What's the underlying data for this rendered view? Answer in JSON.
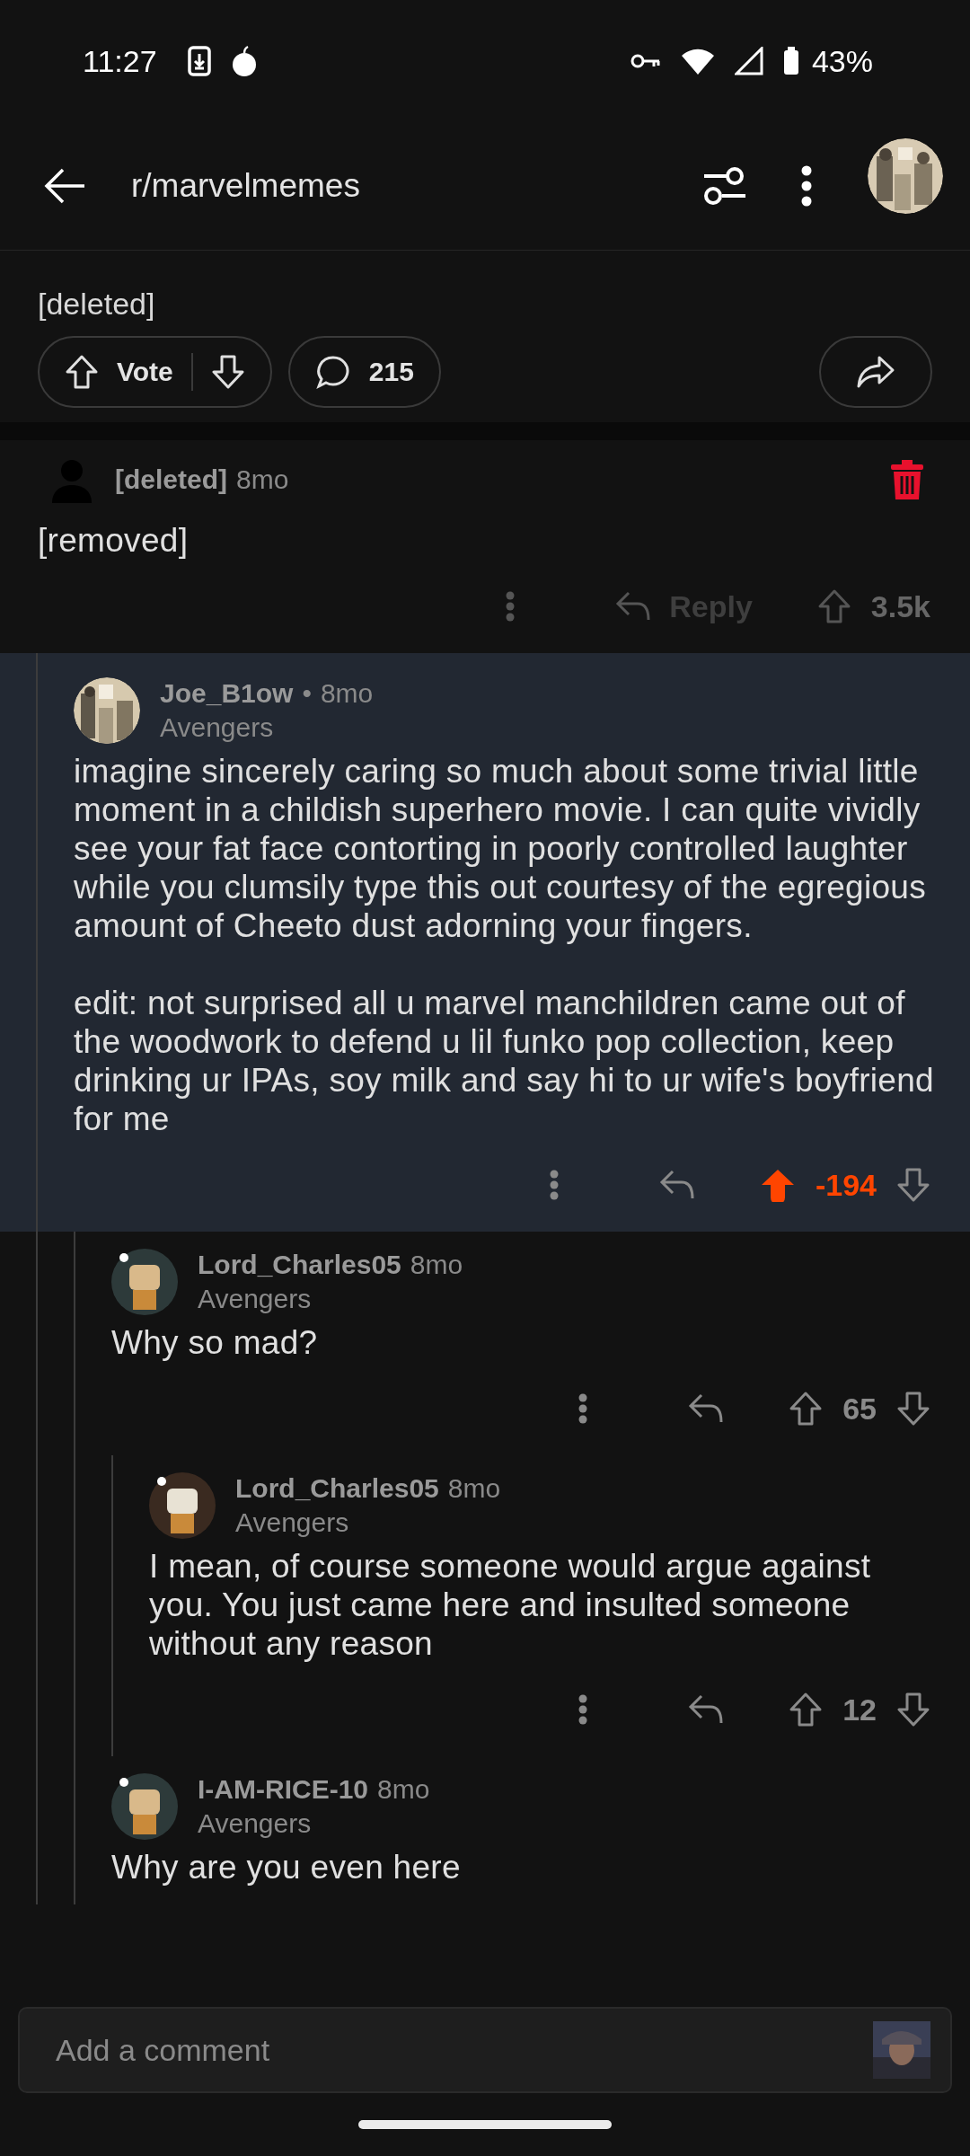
{
  "status_bar": {
    "time": "11:27",
    "battery": "43%"
  },
  "top_bar": {
    "title": "r/marvelmemes"
  },
  "post": {
    "body": "[deleted]",
    "vote_label": "Vote",
    "comment_count": "215"
  },
  "comments": [
    {
      "deleted": true,
      "author": "[deleted]",
      "time": "8mo",
      "body": "[removed]",
      "reply_label": "Reply",
      "score": "3.5k",
      "upvoted": false,
      "highlighted": false,
      "children": [
        {
          "deleted": false,
          "author": "Joe_B1ow",
          "separator": "•",
          "time": "8mo",
          "flair": "Avengers",
          "body": "imagine sincerely caring so much about some trivial little moment in a childish superhero movie. I can quite vividly see your fat face contorting in poorly controlled laughter while you clumsily type this out courtesy of the egregious amount of Cheeto dust adorning your fingers.\n\nedit: not surprised all u marvel manchildren came out of the woodwork to defend u lil funko pop collection, keep drinking ur IPAs, soy milk and say hi to ur wife's boyfriend for me",
          "score": "-194",
          "upvoted": true,
          "highlighted": true,
          "children": [
            {
              "deleted": false,
              "author": "Lord_Charles05",
              "time": "8mo",
              "flair": "Avengers",
              "body": "Why so mad?",
              "score": "65",
              "upvoted": false,
              "highlighted": false,
              "children": [
                {
                  "deleted": false,
                  "author": "Lord_Charles05",
                  "time": "8mo",
                  "flair": "Avengers",
                  "body": "I mean, of course someone would argue against you. You just came here and insulted someone without any reason",
                  "score": "12",
                  "upvoted": false,
                  "highlighted": false
                }
              ]
            },
            {
              "deleted": false,
              "author": "I-AM-RICE-10",
              "time": "8mo",
              "flair": "Avengers",
              "body": "Why are you even here",
              "highlighted": false
            }
          ]
        }
      ]
    }
  ],
  "comment_box": {
    "placeholder": "Add a comment"
  }
}
